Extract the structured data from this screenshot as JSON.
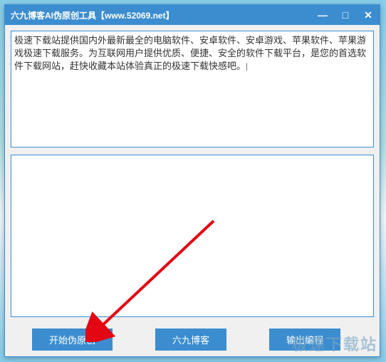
{
  "window": {
    "title": "六九博客AI伪原创工具【www.52069.net】"
  },
  "titlebar": {
    "minimize": "—",
    "maximize": "□",
    "close": "✕"
  },
  "input": {
    "value": "极速下载站提供国内外最新最全的电脑软件、安卓软件、安卓游戏、苹果软件、苹果游戏极速下载服务。为互联网用户提供优质、便捷、安全的软件下载平台，是您的首选软件下载网站，赶快收藏本站体验真正的极速下载快感吧。|"
  },
  "output": {
    "value": ""
  },
  "buttons": {
    "start": "开始伪原创",
    "blog": "六九博客",
    "export": "输出编程"
  },
  "watermark": "极速下载站"
}
